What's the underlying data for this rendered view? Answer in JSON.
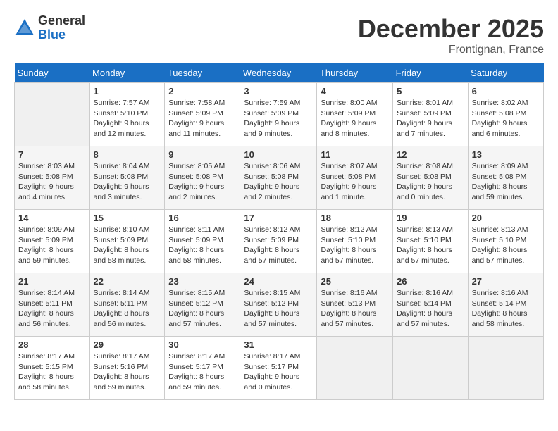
{
  "logo": {
    "general": "General",
    "blue": "Blue"
  },
  "title": "December 2025",
  "location": "Frontignan, France",
  "days_of_week": [
    "Sunday",
    "Monday",
    "Tuesday",
    "Wednesday",
    "Thursday",
    "Friday",
    "Saturday"
  ],
  "weeks": [
    [
      {
        "day": "",
        "sunrise": "",
        "sunset": "",
        "daylight": ""
      },
      {
        "day": "1",
        "sunrise": "Sunrise: 7:57 AM",
        "sunset": "Sunset: 5:10 PM",
        "daylight": "Daylight: 9 hours and 12 minutes."
      },
      {
        "day": "2",
        "sunrise": "Sunrise: 7:58 AM",
        "sunset": "Sunset: 5:09 PM",
        "daylight": "Daylight: 9 hours and 11 minutes."
      },
      {
        "day": "3",
        "sunrise": "Sunrise: 7:59 AM",
        "sunset": "Sunset: 5:09 PM",
        "daylight": "Daylight: 9 hours and 9 minutes."
      },
      {
        "day": "4",
        "sunrise": "Sunrise: 8:00 AM",
        "sunset": "Sunset: 5:09 PM",
        "daylight": "Daylight: 9 hours and 8 minutes."
      },
      {
        "day": "5",
        "sunrise": "Sunrise: 8:01 AM",
        "sunset": "Sunset: 5:09 PM",
        "daylight": "Daylight: 9 hours and 7 minutes."
      },
      {
        "day": "6",
        "sunrise": "Sunrise: 8:02 AM",
        "sunset": "Sunset: 5:08 PM",
        "daylight": "Daylight: 9 hours and 6 minutes."
      }
    ],
    [
      {
        "day": "7",
        "sunrise": "Sunrise: 8:03 AM",
        "sunset": "Sunset: 5:08 PM",
        "daylight": "Daylight: 9 hours and 4 minutes."
      },
      {
        "day": "8",
        "sunrise": "Sunrise: 8:04 AM",
        "sunset": "Sunset: 5:08 PM",
        "daylight": "Daylight: 9 hours and 3 minutes."
      },
      {
        "day": "9",
        "sunrise": "Sunrise: 8:05 AM",
        "sunset": "Sunset: 5:08 PM",
        "daylight": "Daylight: 9 hours and 2 minutes."
      },
      {
        "day": "10",
        "sunrise": "Sunrise: 8:06 AM",
        "sunset": "Sunset: 5:08 PM",
        "daylight": "Daylight: 9 hours and 2 minutes."
      },
      {
        "day": "11",
        "sunrise": "Sunrise: 8:07 AM",
        "sunset": "Sunset: 5:08 PM",
        "daylight": "Daylight: 9 hours and 1 minute."
      },
      {
        "day": "12",
        "sunrise": "Sunrise: 8:08 AM",
        "sunset": "Sunset: 5:08 PM",
        "daylight": "Daylight: 9 hours and 0 minutes."
      },
      {
        "day": "13",
        "sunrise": "Sunrise: 8:09 AM",
        "sunset": "Sunset: 5:08 PM",
        "daylight": "Daylight: 8 hours and 59 minutes."
      }
    ],
    [
      {
        "day": "14",
        "sunrise": "Sunrise: 8:09 AM",
        "sunset": "Sunset: 5:09 PM",
        "daylight": "Daylight: 8 hours and 59 minutes."
      },
      {
        "day": "15",
        "sunrise": "Sunrise: 8:10 AM",
        "sunset": "Sunset: 5:09 PM",
        "daylight": "Daylight: 8 hours and 58 minutes."
      },
      {
        "day": "16",
        "sunrise": "Sunrise: 8:11 AM",
        "sunset": "Sunset: 5:09 PM",
        "daylight": "Daylight: 8 hours and 58 minutes."
      },
      {
        "day": "17",
        "sunrise": "Sunrise: 8:12 AM",
        "sunset": "Sunset: 5:09 PM",
        "daylight": "Daylight: 8 hours and 57 minutes."
      },
      {
        "day": "18",
        "sunrise": "Sunrise: 8:12 AM",
        "sunset": "Sunset: 5:10 PM",
        "daylight": "Daylight: 8 hours and 57 minutes."
      },
      {
        "day": "19",
        "sunrise": "Sunrise: 8:13 AM",
        "sunset": "Sunset: 5:10 PM",
        "daylight": "Daylight: 8 hours and 57 minutes."
      },
      {
        "day": "20",
        "sunrise": "Sunrise: 8:13 AM",
        "sunset": "Sunset: 5:10 PM",
        "daylight": "Daylight: 8 hours and 57 minutes."
      }
    ],
    [
      {
        "day": "21",
        "sunrise": "Sunrise: 8:14 AM",
        "sunset": "Sunset: 5:11 PM",
        "daylight": "Daylight: 8 hours and 56 minutes."
      },
      {
        "day": "22",
        "sunrise": "Sunrise: 8:14 AM",
        "sunset": "Sunset: 5:11 PM",
        "daylight": "Daylight: 8 hours and 56 minutes."
      },
      {
        "day": "23",
        "sunrise": "Sunrise: 8:15 AM",
        "sunset": "Sunset: 5:12 PM",
        "daylight": "Daylight: 8 hours and 57 minutes."
      },
      {
        "day": "24",
        "sunrise": "Sunrise: 8:15 AM",
        "sunset": "Sunset: 5:12 PM",
        "daylight": "Daylight: 8 hours and 57 minutes."
      },
      {
        "day": "25",
        "sunrise": "Sunrise: 8:16 AM",
        "sunset": "Sunset: 5:13 PM",
        "daylight": "Daylight: 8 hours and 57 minutes."
      },
      {
        "day": "26",
        "sunrise": "Sunrise: 8:16 AM",
        "sunset": "Sunset: 5:14 PM",
        "daylight": "Daylight: 8 hours and 57 minutes."
      },
      {
        "day": "27",
        "sunrise": "Sunrise: 8:16 AM",
        "sunset": "Sunset: 5:14 PM",
        "daylight": "Daylight: 8 hours and 58 minutes."
      }
    ],
    [
      {
        "day": "28",
        "sunrise": "Sunrise: 8:17 AM",
        "sunset": "Sunset: 5:15 PM",
        "daylight": "Daylight: 8 hours and 58 minutes."
      },
      {
        "day": "29",
        "sunrise": "Sunrise: 8:17 AM",
        "sunset": "Sunset: 5:16 PM",
        "daylight": "Daylight: 8 hours and 59 minutes."
      },
      {
        "day": "30",
        "sunrise": "Sunrise: 8:17 AM",
        "sunset": "Sunset: 5:17 PM",
        "daylight": "Daylight: 8 hours and 59 minutes."
      },
      {
        "day": "31",
        "sunrise": "Sunrise: 8:17 AM",
        "sunset": "Sunset: 5:17 PM",
        "daylight": "Daylight: 9 hours and 0 minutes."
      },
      {
        "day": "",
        "sunrise": "",
        "sunset": "",
        "daylight": ""
      },
      {
        "day": "",
        "sunrise": "",
        "sunset": "",
        "daylight": ""
      },
      {
        "day": "",
        "sunrise": "",
        "sunset": "",
        "daylight": ""
      }
    ]
  ]
}
